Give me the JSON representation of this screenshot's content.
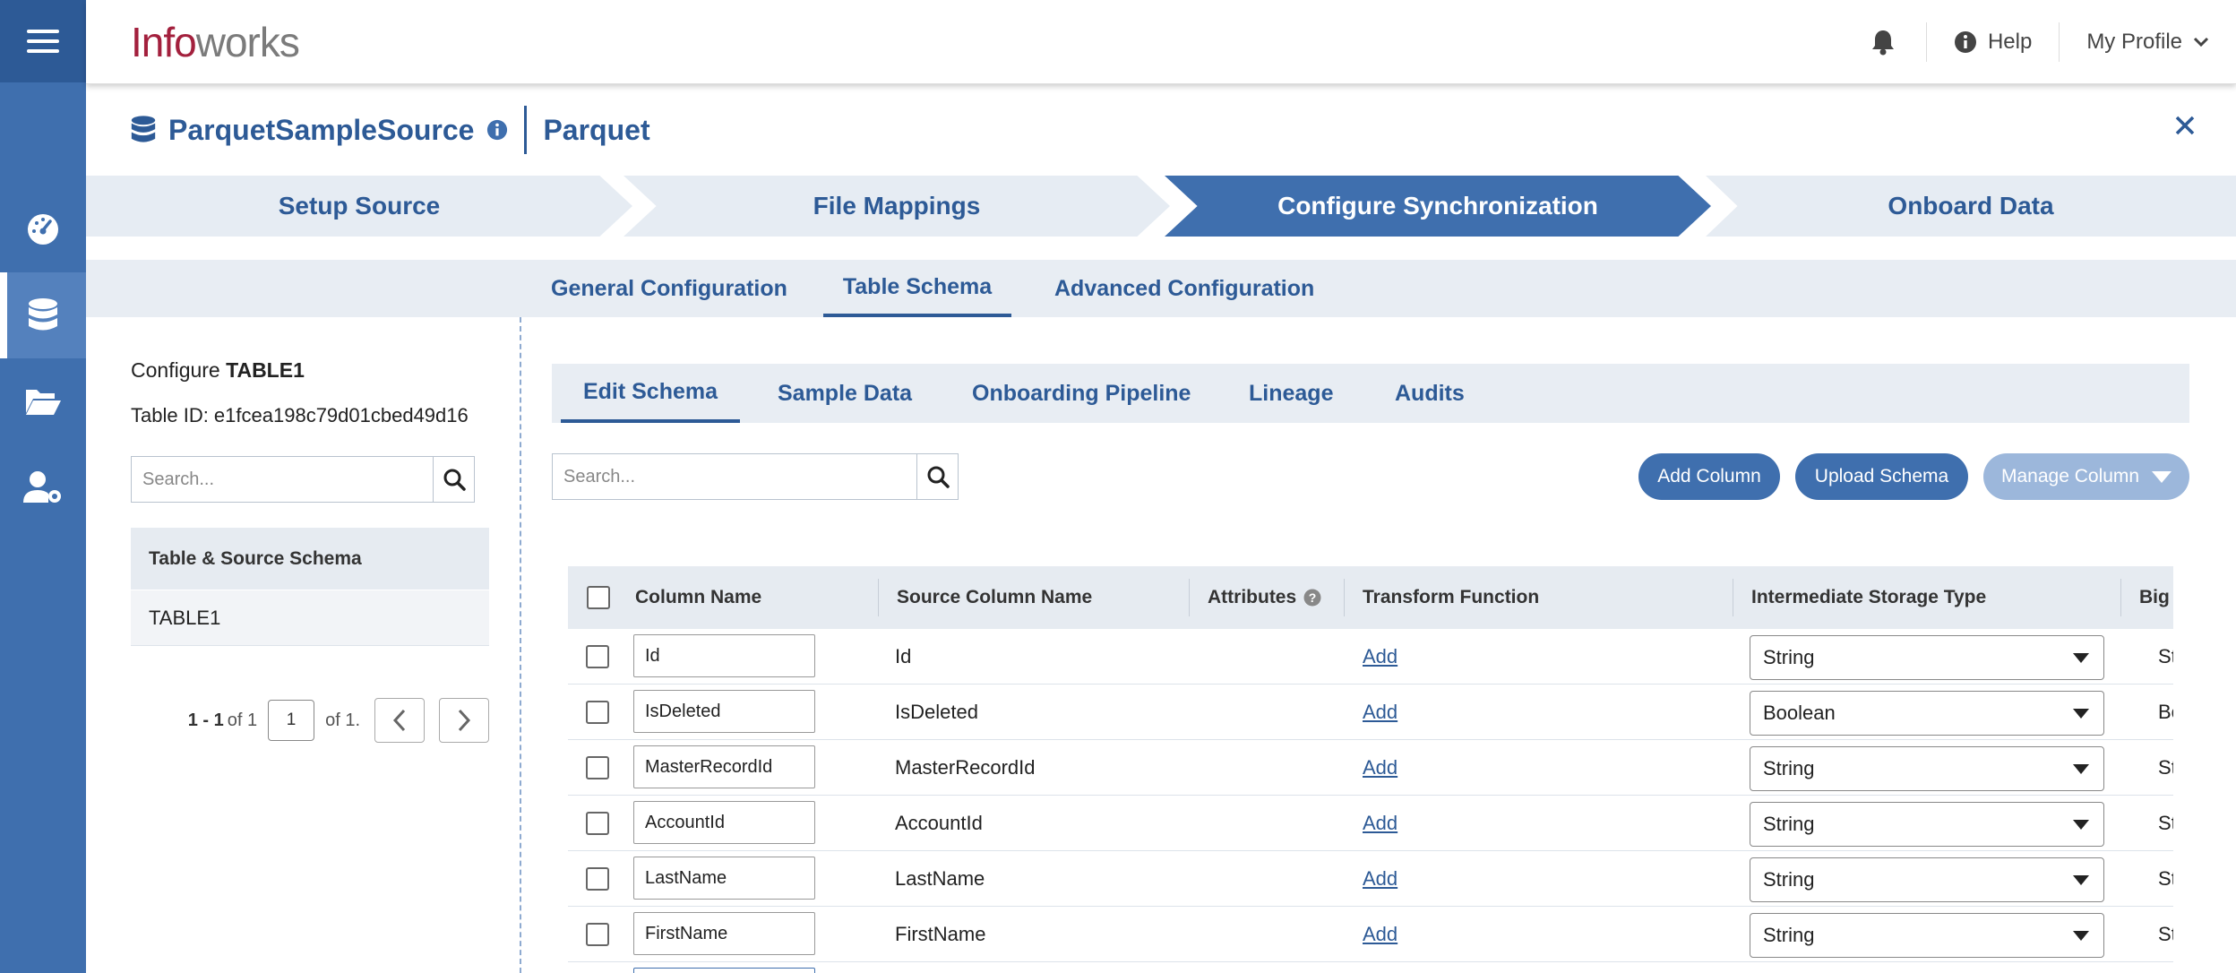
{
  "app": {
    "logo_part1": "Info",
    "logo_part2": "works",
    "help_label": "Help",
    "profile_label": "My Profile"
  },
  "source": {
    "name": "ParquetSampleSource",
    "type": "Parquet"
  },
  "steps": [
    "Setup Source",
    "File Mappings",
    "Configure Synchronization",
    "Onboard Data"
  ],
  "subtabs": [
    "General Configuration",
    "Table Schema",
    "Advanced Configuration"
  ],
  "left": {
    "configure_prefix": "Configure ",
    "configure_table": "TABLE1",
    "table_id": "Table ID: e1fcea198c79d01cbed49d16",
    "search_placeholder": "Search...",
    "list_header": "Table & Source Schema",
    "list_items": [
      "TABLE1"
    ],
    "pager_range": "1 - 1",
    "pager_of_total": " of 1",
    "pager_page": "1",
    "pager_of_pages": "of 1."
  },
  "inner_tabs": [
    "Edit Schema",
    "Sample Data",
    "Onboarding Pipeline",
    "Lineage",
    "Audits"
  ],
  "schema": {
    "search_placeholder": "Search...",
    "add_column": "Add Column",
    "upload_schema": "Upload Schema",
    "manage_column": "Manage Column",
    "headers": [
      "Column Name",
      "Source Column Name",
      "Attributes",
      "Transform Function",
      "Intermediate Storage Type",
      "Big"
    ],
    "add_link": "Add",
    "rows": [
      {
        "name": "Id",
        "source": "Id",
        "type": "String",
        "big": "St"
      },
      {
        "name": "IsDeleted",
        "source": "IsDeleted",
        "type": "Boolean",
        "big": "Bo"
      },
      {
        "name": "MasterRecordId",
        "source": "MasterRecordId",
        "type": "String",
        "big": "St"
      },
      {
        "name": "AccountId",
        "source": "AccountId",
        "type": "String",
        "big": "St"
      },
      {
        "name": "LastName",
        "source": "LastName",
        "type": "String",
        "big": "St"
      },
      {
        "name": "FirstName",
        "source": "FirstName",
        "type": "String",
        "big": "St"
      }
    ]
  },
  "colors": {
    "primary": "#2d5a96",
    "rail": "#3f6fae",
    "logo_red": "#a3203d"
  }
}
